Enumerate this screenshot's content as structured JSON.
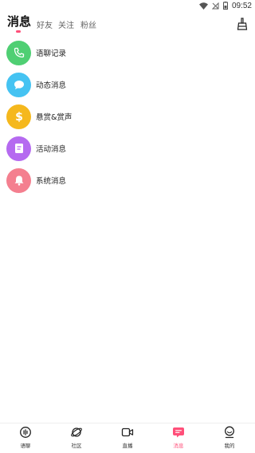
{
  "status_bar": {
    "time": "09:52"
  },
  "header": {
    "tabs": [
      {
        "label": "消息",
        "active": true
      },
      {
        "label": "好友",
        "active": false
      },
      {
        "label": "关注",
        "active": false
      },
      {
        "label": "粉丝",
        "active": false
      }
    ],
    "accent_color": "#ff4f79"
  },
  "list": [
    {
      "label": "语聊记录",
      "icon": "phone-icon",
      "color": "#4fcf73"
    },
    {
      "label": "动态消息",
      "icon": "chat-bubble-icon",
      "color": "#45c3f2"
    },
    {
      "label": "悬赏&赏声",
      "icon": "dollar-icon",
      "color": "#f5b81d"
    },
    {
      "label": "活动消息",
      "icon": "document-icon",
      "color": "#b56af0"
    },
    {
      "label": "系统消息",
      "icon": "bell-icon",
      "color": "#f47f8f"
    }
  ],
  "bottom_nav": [
    {
      "label": "语聊",
      "icon": "voice-chat-icon",
      "active": false
    },
    {
      "label": "社区",
      "icon": "planet-icon",
      "active": false
    },
    {
      "label": "直播",
      "icon": "video-camera-icon",
      "active": false
    },
    {
      "label": "消息",
      "icon": "message-icon",
      "active": true
    },
    {
      "label": "我的",
      "icon": "profile-icon",
      "active": false
    }
  ]
}
